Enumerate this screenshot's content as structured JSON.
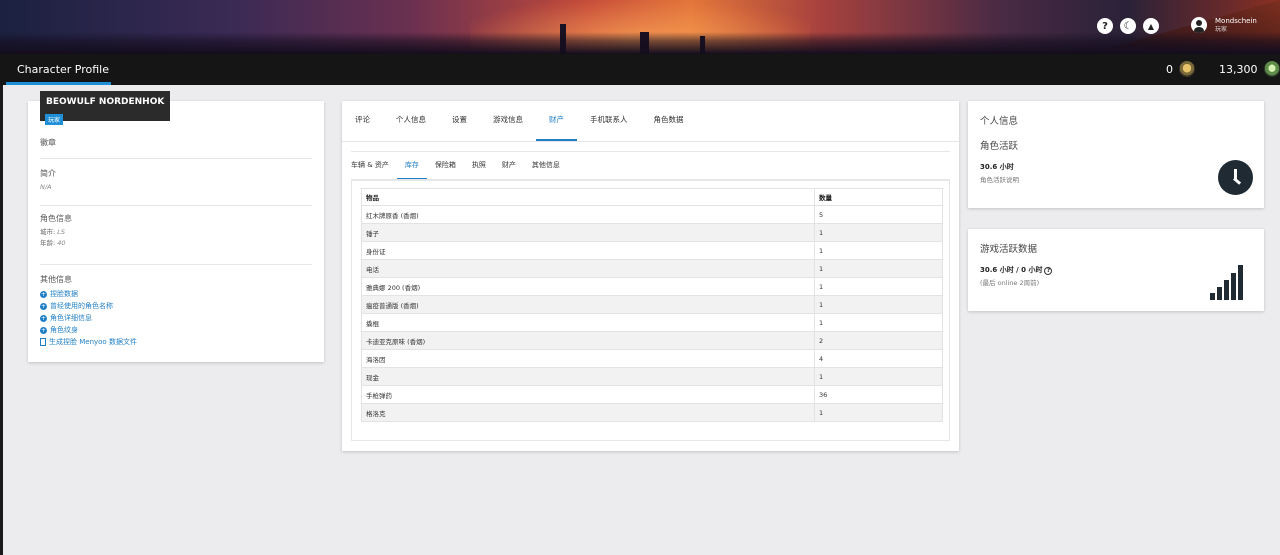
{
  "header": {
    "icons": [
      "help-icon",
      "moon-icon",
      "bell-icon"
    ],
    "user": {
      "name": "Mondschein",
      "role": "玩家"
    }
  },
  "topbar": {
    "title": "Character Profile",
    "currency_a": "0",
    "currency_b": "13,300"
  },
  "profile": {
    "name": "BEOWULF NORDENHOK",
    "role": "玩家",
    "badge_label": "徽章",
    "intro_label": "简介",
    "intro_value": "N/A",
    "char_info_label": "角色信息",
    "city_label": "城市:",
    "city_value": "LS",
    "age_label": "年龄:",
    "age_value": "40",
    "other_label": "其他信息",
    "links": [
      "捏脸数据",
      "曾经使用的角色名称",
      "角色详细信息",
      "角色纹身",
      "生成捏脸 Menyoo 数据文件"
    ]
  },
  "main": {
    "tabs": [
      "评论",
      "个人信息",
      "设置",
      "游戏信息",
      "财产",
      "手机联系人",
      "角色数据"
    ],
    "active_tab": 4,
    "subtabs": [
      "车辆 & 资产",
      "库存",
      "保险箱",
      "执照",
      "财产",
      "其他信息"
    ],
    "active_subtab": 1,
    "table": {
      "headers": [
        "物品",
        "数量"
      ],
      "rows": [
        [
          "红木牌原香 (香烟)",
          "5"
        ],
        [
          "锤子",
          "1"
        ],
        [
          "身份证",
          "1"
        ],
        [
          "电话",
          "1"
        ],
        [
          "雅典娜 200 (香烟)",
          "1"
        ],
        [
          "瘟疫普通版 (香烟)",
          "1"
        ],
        [
          "撬棍",
          "1"
        ],
        [
          "卡迪亚克原味 (香烟)",
          "2"
        ],
        [
          "海洛因",
          "4"
        ],
        [
          "现金",
          "1"
        ],
        [
          "手枪弹药",
          "36"
        ],
        [
          "格洛克",
          "1"
        ]
      ]
    }
  },
  "right": {
    "card1_title": "个人信息",
    "card1_sub": "角色活跃",
    "card1_value": "30.6 小时",
    "card1_note": "角色活跃说明",
    "card2_title": "游戏活跃数据",
    "card2_value": "30.6 小时 / 0 小时",
    "card2_note": "(最后 online 2周前)"
  },
  "colors": {
    "accent": "#1f8fd8",
    "topbar": "#151515",
    "icon_dark": "#1f2a33"
  }
}
